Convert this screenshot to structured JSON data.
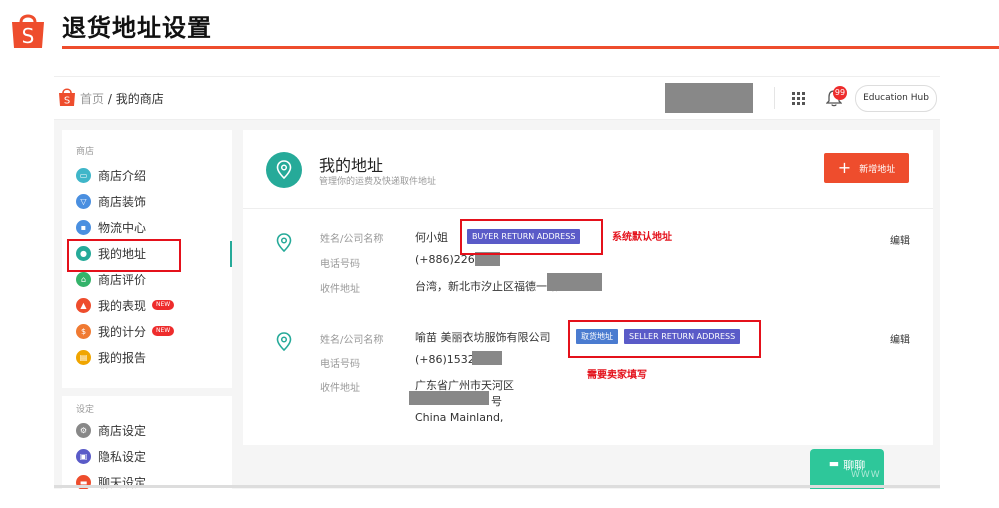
{
  "slide": {
    "title": "退货地址设置",
    "logo_letter": "S"
  },
  "colors": {
    "brand": "#ee4d2d",
    "teal": "#26aa99",
    "annotation": "#e4111b",
    "tag_purple": "#5a5bc8",
    "tag_blue": "#4a7bd0"
  },
  "topbar": {
    "breadcrumb_home": "首页",
    "breadcrumb_sep": " / ",
    "breadcrumb_current": "我的商店",
    "notification_count": "99",
    "education_hub": "Education Hub"
  },
  "sidebar": {
    "section_store": "商店",
    "section_settings": "设定",
    "items": [
      {
        "label": "商店介绍",
        "color": "#3fb6c9",
        "icon": "id-card-icon"
      },
      {
        "label": "商店装饰",
        "color": "#4a8fe0",
        "icon": "brush-icon"
      },
      {
        "label": "物流中心",
        "color": "#4a8fe0",
        "icon": "truck-icon"
      },
      {
        "label": "我的地址",
        "color": "#26aa99",
        "icon": "pin-icon",
        "active": true
      },
      {
        "label": "商店评价",
        "color": "#34b36a",
        "icon": "star-icon"
      },
      {
        "label": "我的表现",
        "color": "#ee4d2d",
        "icon": "chart-icon",
        "badge": "NEW"
      },
      {
        "label": "我的计分",
        "color": "#f07a32",
        "icon": "score-icon",
        "badge": "NEW"
      },
      {
        "label": "我的报告",
        "color": "#f0a500",
        "icon": "report-icon"
      }
    ],
    "settings_items": [
      {
        "label": "商店设定",
        "color": "#888888",
        "icon": "gear-icon"
      },
      {
        "label": "隐私设定",
        "color": "#5a5bc8",
        "icon": "lock-icon"
      },
      {
        "label": "聊天设定",
        "color": "#ee4d2d",
        "icon": "chat-icon"
      }
    ]
  },
  "main": {
    "title": "我的地址",
    "subtitle": "管理你的运费及快递取件地址",
    "add_button": "新增地址",
    "addresses": [
      {
        "name_label": "姓名/公司名称",
        "name_value": "何小姐",
        "phone_label": "电话号码",
        "phone_value": "(+886)22695",
        "address_label": "收件地址",
        "address_line1": "台湾，新北市汐止区福德一路",
        "tags": [
          "BUYER RETURN ADDRESS"
        ],
        "edit": "编辑"
      },
      {
        "name_label": "姓名/公司名称",
        "name_value": "喻苗 美丽衣坊服饰有限公司",
        "phone_label": "电话号码",
        "phone_value": "(+86)153272",
        "address_label": "收件地址",
        "address_line1": "广东省广州市天河区",
        "address_line2": "号",
        "address_line3": "China Mainland,",
        "tags": [
          "取货地址",
          "SELLER RETURN ADDRESS"
        ],
        "edit": "编辑"
      }
    ]
  },
  "annotations": {
    "system_default": "系统默认地址",
    "seller_fill": "需要卖家填写"
  },
  "chat_button": "聊聊",
  "watermark": "WWW"
}
